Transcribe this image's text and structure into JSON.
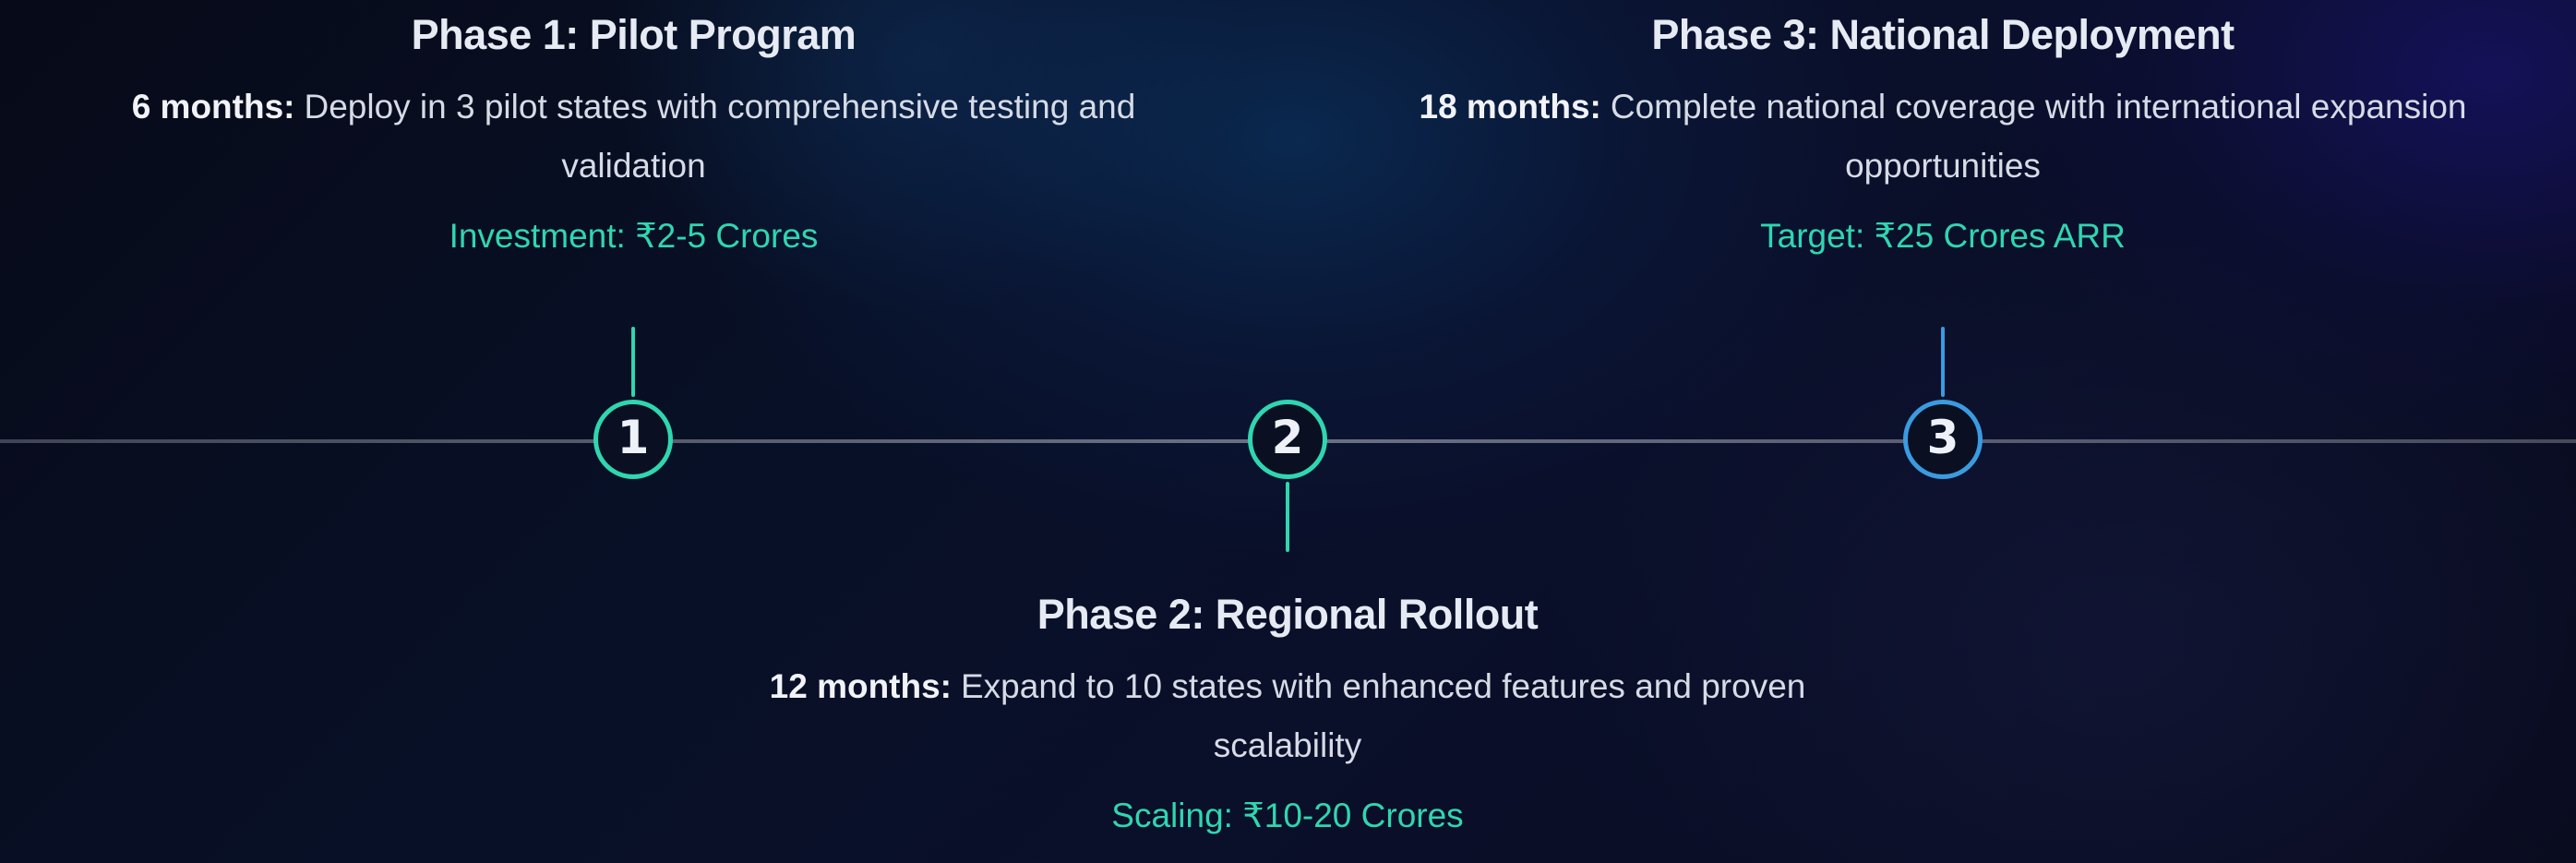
{
  "colors": {
    "accent_teal": "#2fd6b0",
    "accent_blue": "#3a9be0",
    "background": "#080a1c",
    "line": "#8c91a0"
  },
  "phases": [
    {
      "number": "1",
      "title": "Phase 1: Pilot Program",
      "duration": "6 months:",
      "description": "Deploy in 3 pilot states with comprehensive testing and validation",
      "metric": "Investment: ₹2-5 Crores"
    },
    {
      "number": "2",
      "title": "Phase 2: Regional Rollout",
      "duration": "12 months:",
      "description": "Expand to 10 states with enhanced features and proven scalability",
      "metric": "Scaling: ₹10-20 Crores"
    },
    {
      "number": "3",
      "title": "Phase 3: National Deployment",
      "duration": "18 months:",
      "description": "Complete national coverage with international expansion opportunities",
      "metric": "Target: ₹25 Crores ARR"
    }
  ]
}
